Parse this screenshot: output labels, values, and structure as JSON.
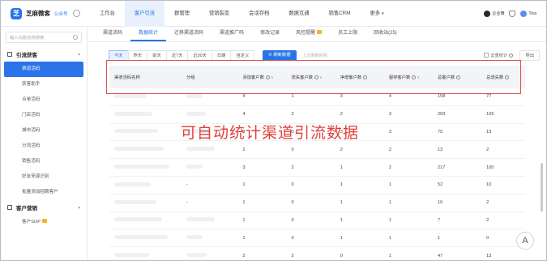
{
  "brand": {
    "name": "芝麻微客",
    "sub": "公众号"
  },
  "nav": {
    "items": [
      "工作台",
      "客户引流",
      "群管理",
      "营销裂变",
      "会话存档",
      "数据互通",
      "销售CRM",
      "更多"
    ],
    "active_index": 1
  },
  "user": {
    "org": "企业微",
    "name": "Tina"
  },
  "sidebar": {
    "search_placeholder": "输入功能名称搜索",
    "group1": "引流获客",
    "items": [
      "渠道活码",
      "获客助手",
      "点单活码",
      "门店活码",
      "城市活码",
      "分流活码",
      "销售活码",
      "好友来源识别",
      "批量添加招聘客户"
    ],
    "active_index": 0,
    "group2": "客户营销",
    "sop": "客户SOP"
  },
  "subtabs": {
    "items": [
      "渠道活码",
      "数据统计",
      "迁移渠道活码",
      "渠道推广码",
      "修改记录",
      "风控提醒",
      "员工上限",
      "回收站(25)"
    ],
    "active_index": 1
  },
  "filters": {
    "ranges": [
      "今天",
      "昨天",
      "前天",
      "近7天",
      "近30天",
      "日期",
      "自定义"
    ],
    "active_index": 0,
    "refresh": "刷新数据",
    "updated": "上次更新时间：",
    "dedupe": "去重统计",
    "export": "导出"
  },
  "table": {
    "headers": [
      "渠道活码名称",
      "分组",
      "添加客户数",
      "流失客户数",
      "净增客户数",
      "留存客户数",
      "总客户数",
      "总流失数"
    ],
    "rows": [
      [
        "",
        "",
        "4",
        "1",
        "3",
        "4",
        "158",
        "77"
      ],
      [
        "",
        "",
        "4",
        "2",
        "2",
        "3",
        "203",
        "105"
      ],
      [
        "",
        "",
        "3",
        "0",
        "3",
        "3",
        "75",
        "19"
      ],
      [
        "",
        "",
        "2",
        "0",
        "2",
        "2",
        "13",
        "2"
      ],
      [
        "",
        "",
        "3",
        "2",
        "1",
        "2",
        "217",
        "100"
      ],
      [
        "",
        "-",
        "1",
        "0",
        "1",
        "1",
        "52",
        "10"
      ],
      [
        "",
        "-",
        "1",
        "0",
        "1",
        "1",
        "10",
        "2"
      ],
      [
        "",
        "",
        "1",
        "0",
        "1",
        "1",
        "7",
        "2"
      ],
      [
        "",
        "",
        "1",
        "0",
        "1",
        "1",
        "1",
        "0"
      ],
      [
        "",
        "",
        "2",
        "2",
        "0",
        "1",
        "47",
        "13"
      ]
    ]
  },
  "overlay_text": "可自动统计渠道引流数据",
  "fab": "A",
  "colors": {
    "accent": "#2a73e8",
    "highlight": "#d9534f",
    "overlay": "#e0403a"
  }
}
